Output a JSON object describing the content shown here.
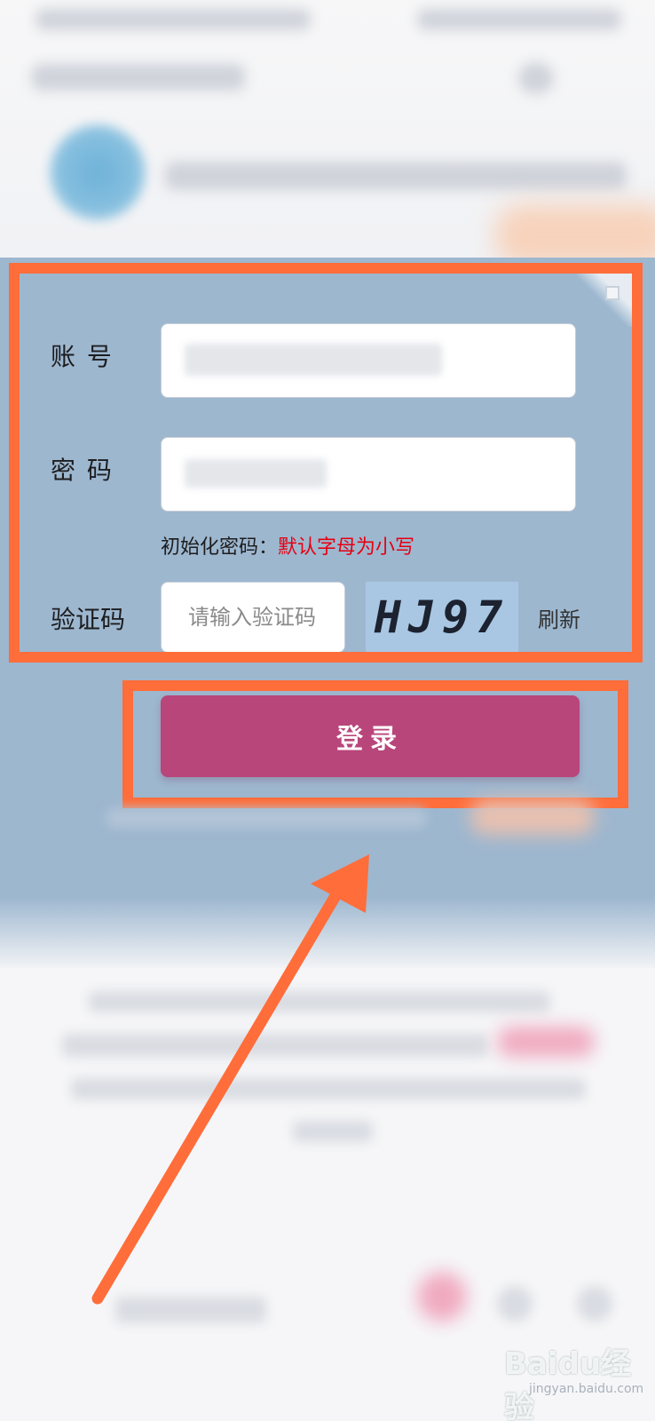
{
  "form": {
    "account_label": "账  号",
    "password_label": "密  码",
    "hint_prefix": "初始化密码：",
    "hint_value": "默认字母为小写",
    "captcha_label": "验证码",
    "captcha_placeholder": "请输入验证码",
    "captcha_text": "HJ97",
    "refresh_label": "刷新",
    "login_label": "登录"
  },
  "watermark": {
    "logo_text": "Baidu经验",
    "url": "jingyan.baidu.com"
  },
  "colors": {
    "panel_bg": "#9db7cf",
    "login_button": "#b8467b",
    "highlight": "#ff6d3a",
    "hint_red": "#e60012"
  }
}
